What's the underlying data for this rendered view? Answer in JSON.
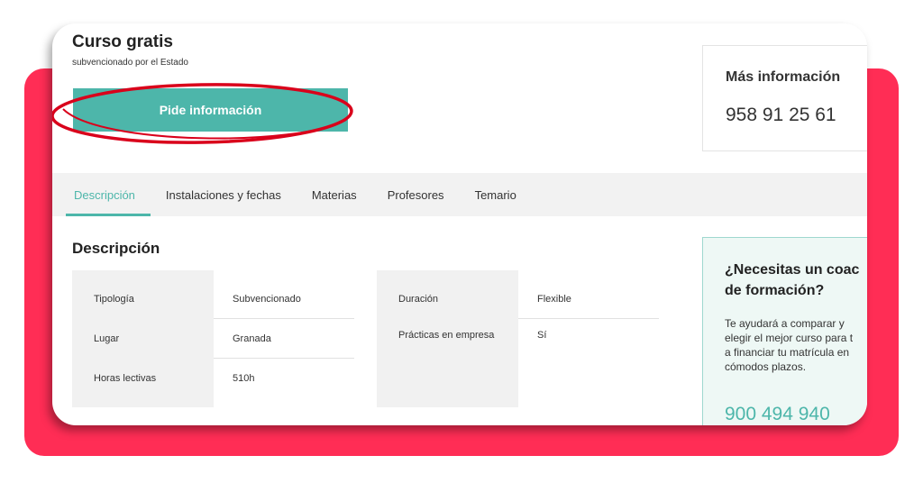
{
  "course": {
    "title": "Curso gratis",
    "subtitle": "subvencionado por el Estado",
    "cta_label": "Pide información"
  },
  "info": {
    "title": "Más información",
    "phone": "958 91 25 61"
  },
  "tabs": [
    {
      "label": "Descripción",
      "active": true
    },
    {
      "label": "Instalaciones y fechas"
    },
    {
      "label": "Materias"
    },
    {
      "label": "Profesores"
    },
    {
      "label": "Temario"
    }
  ],
  "description": {
    "heading": "Descripción",
    "left": [
      {
        "label": "Tipología",
        "value": "Subvencionado"
      },
      {
        "label": "Lugar",
        "value": "Granada"
      },
      {
        "label": "Horas lectivas",
        "value": "510h"
      }
    ],
    "right": [
      {
        "label": "Duración",
        "value": "Flexible"
      },
      {
        "label": "Prácticas en empresa",
        "value": "Sí"
      }
    ]
  },
  "coach": {
    "title_line1": "¿Necesitas un coac",
    "title_line2": "de formación?",
    "text_lines": [
      "Te ayudará a comparar y",
      "elegir el mejor curso para t",
      "a financiar tu matrícula en",
      "cómodos plazos."
    ],
    "phone": "900 494 940"
  },
  "colors": {
    "accent": "#4db6aa",
    "background_frame": "#ff2d55",
    "highlight_ellipse": "#d9001b"
  }
}
